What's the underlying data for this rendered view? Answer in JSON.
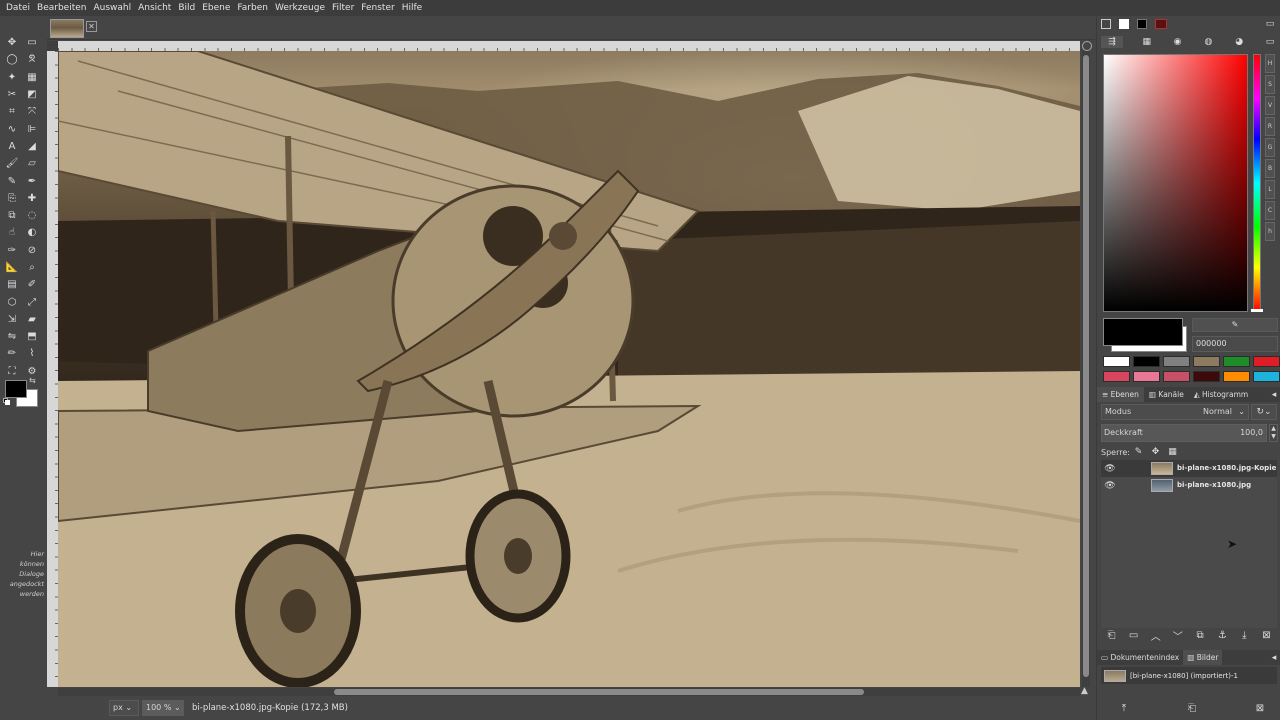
{
  "menu": [
    "Datei",
    "Bearbeiten",
    "Auswahl",
    "Ansicht",
    "Bild",
    "Ebene",
    "Farben",
    "Werkzeuge",
    "Filter",
    "Fenster",
    "Hilfe"
  ],
  "toolbox": {
    "tools": [
      {
        "name": "move-tool-icon",
        "glyph": "✥"
      },
      {
        "name": "rect-select-tool-icon",
        "glyph": "▭"
      },
      {
        "name": "ellipse-select-tool-icon",
        "glyph": "◯"
      },
      {
        "name": "free-select-tool-icon",
        "glyph": "ᘝ"
      },
      {
        "name": "fuzzy-select-tool-icon",
        "glyph": "✦"
      },
      {
        "name": "select-by-color-tool-icon",
        "glyph": "▦"
      },
      {
        "name": "scissors-select-tool-icon",
        "glyph": "✂"
      },
      {
        "name": "foreground-select-tool-icon",
        "glyph": "◩"
      },
      {
        "name": "crop-tool-icon",
        "glyph": "⌗"
      },
      {
        "name": "unified-transform-tool-icon",
        "glyph": "⤧"
      },
      {
        "name": "warp-transform-tool-icon",
        "glyph": "∿"
      },
      {
        "name": "align-tool-icon",
        "glyph": "⊫"
      },
      {
        "name": "text-tool-icon",
        "glyph": "A"
      },
      {
        "name": "bucket-fill-tool-icon",
        "glyph": "◢"
      },
      {
        "name": "paintbrush-tool-icon",
        "glyph": "🖌"
      },
      {
        "name": "eraser-tool-icon",
        "glyph": "▱"
      },
      {
        "name": "airbrush-tool-icon",
        "glyph": "✎"
      },
      {
        "name": "ink-tool-icon",
        "glyph": "✒"
      },
      {
        "name": "clone-tool-icon",
        "glyph": "⎘"
      },
      {
        "name": "heal-tool-icon",
        "glyph": "✚"
      },
      {
        "name": "perspective-clone-tool-icon",
        "glyph": "⧉"
      },
      {
        "name": "blur-tool-icon",
        "glyph": "◌"
      },
      {
        "name": "smudge-tool-icon",
        "glyph": "☝"
      },
      {
        "name": "dodge-burn-tool-icon",
        "glyph": "◐"
      },
      {
        "name": "paths-tool-icon",
        "glyph": "✑"
      },
      {
        "name": "color-picker-tool-icon",
        "glyph": "⊘"
      },
      {
        "name": "measure-tool-icon",
        "glyph": "📐"
      },
      {
        "name": "zoom-tool-icon",
        "glyph": "⌕"
      },
      {
        "name": "gradient-tool-icon",
        "glyph": "▤"
      },
      {
        "name": "mypaint-brush-tool-icon",
        "glyph": "✐"
      },
      {
        "name": "cage-transform-tool-icon",
        "glyph": "⬡"
      },
      {
        "name": "handle-transform-tool-icon",
        "glyph": "⤢"
      },
      {
        "name": "scale-tool-icon",
        "glyph": "⇲"
      },
      {
        "name": "shear-tool-icon",
        "glyph": "▰"
      },
      {
        "name": "flip-tool-icon",
        "glyph": "⇋"
      },
      {
        "name": "perspective-tool-icon",
        "glyph": "⬒"
      },
      {
        "name": "pencil-tool-icon",
        "glyph": "✏"
      },
      {
        "name": "smudge-alt-tool-icon",
        "glyph": "⌇"
      },
      {
        "name": "paint-select-tool-icon",
        "glyph": "⛶"
      },
      {
        "name": "gegl-tool-icon",
        "glyph": "⚙"
      }
    ],
    "dock_hint": [
      "Hier",
      "können",
      "Dialoge",
      "angedockt",
      "werden"
    ]
  },
  "status": {
    "unit": "px",
    "zoom": "100 %",
    "text": "bi-plane-x1080.jpg-Kopie (172,3 MB)"
  },
  "dock": {
    "top_icons": [
      "foreground-background-icon",
      "white-icon",
      "black-icon",
      "red-pattern-icon",
      "monitor-icon"
    ],
    "color_tabs": [
      "gimp-selector-icon",
      "cmyk-selector-icon",
      "triangle-selector-icon",
      "wheel-selector-icon",
      "watercolor-selector-icon",
      "scales-selector-icon"
    ],
    "scale_buttons": [
      "H",
      "S",
      "V",
      "R",
      "G",
      "B",
      "L",
      "C",
      "h"
    ],
    "hex_value": "000000",
    "palette": [
      "#ffffff",
      "#000000",
      "#808080",
      "#8c7b5e",
      "#1e8c28",
      "#e01c24",
      "#d9455f",
      "#e87896",
      "#c85064",
      "#3c0a0a",
      "#ff8c00",
      "#1cb4dc"
    ]
  },
  "layers": {
    "tabs": [
      "Ebenen",
      "Kanäle",
      "Histogramm"
    ],
    "mode_label": "Modus",
    "mode_value": "Normal",
    "opacity_label": "Deckkraft",
    "opacity_value": "100,0",
    "lock_label": "Sperre:",
    "items": [
      {
        "name": "bi-plane-x1080.jpg-Kopie",
        "visible": true,
        "selected": true
      },
      {
        "name": "bi-plane-x1080.jpg",
        "visible": true,
        "selected": false
      }
    ]
  },
  "images_panel": {
    "tabs": [
      "Dokumentenindex",
      "Bilder"
    ],
    "item": "[bi-plane-x1080] (importiert)-1"
  }
}
